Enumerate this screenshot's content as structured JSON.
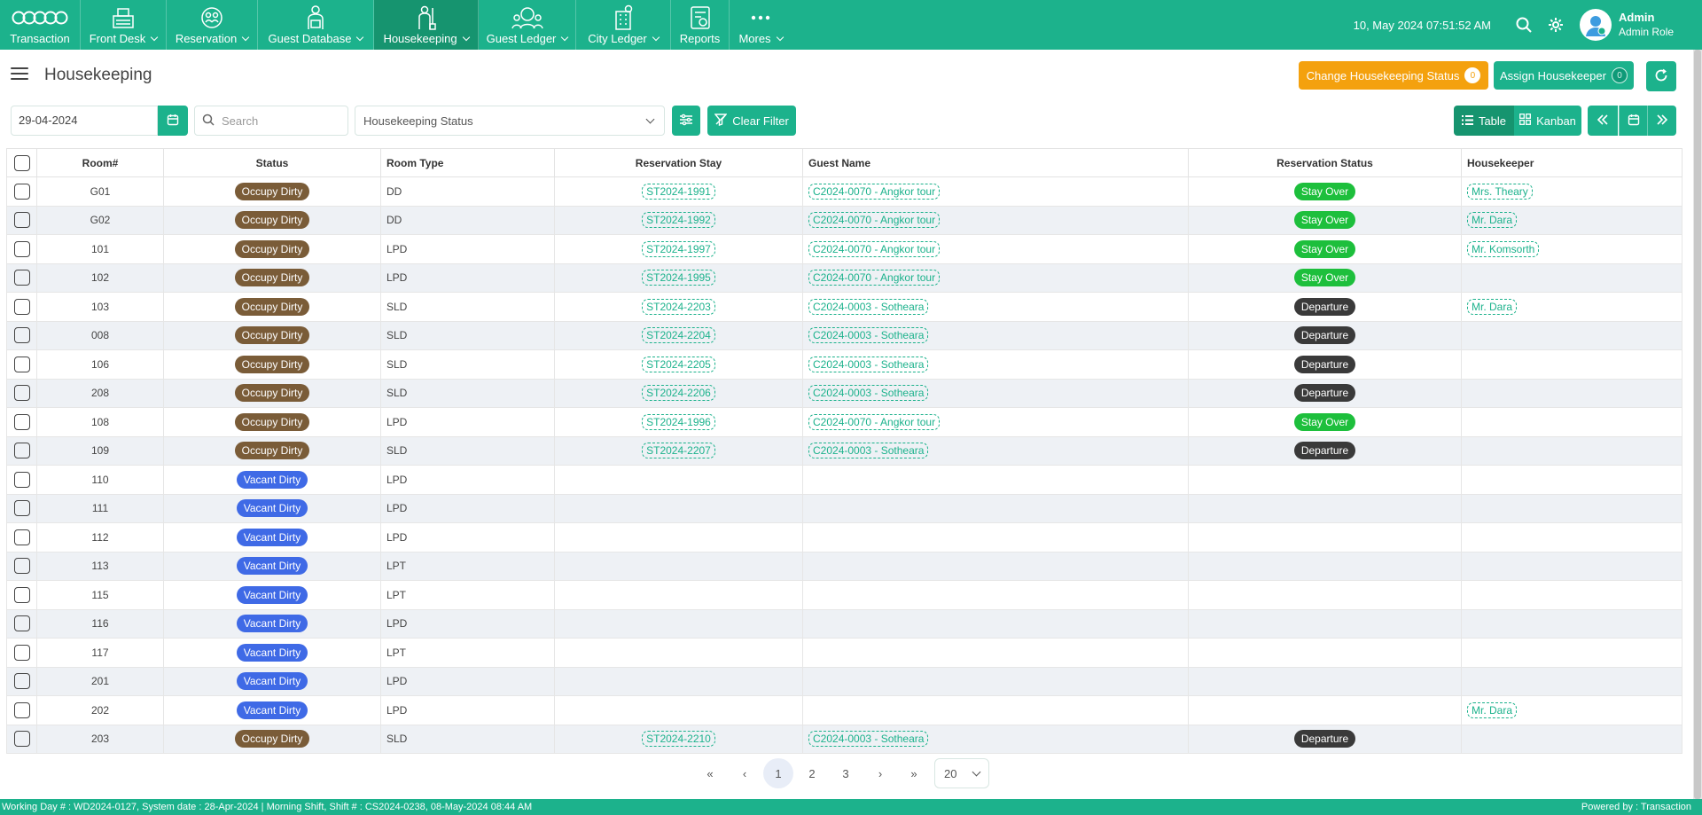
{
  "nav": {
    "items": [
      {
        "label": "Transaction",
        "icon": "transaction-icon",
        "caret": false
      },
      {
        "label": "Front Desk",
        "icon": "front-desk-icon",
        "caret": true
      },
      {
        "label": "Reservation",
        "icon": "reservation-icon",
        "caret": true
      },
      {
        "label": "Guest Database",
        "icon": "guest-database-icon",
        "caret": true
      },
      {
        "label": "Housekeeping",
        "icon": "housekeeping-icon",
        "caret": true,
        "active": true
      },
      {
        "label": "Guest Ledger",
        "icon": "guest-ledger-icon",
        "caret": true
      },
      {
        "label": "City Ledger",
        "icon": "city-ledger-icon",
        "caret": true
      },
      {
        "label": "Reports",
        "icon": "reports-icon",
        "caret": false
      },
      {
        "label": "Mores",
        "icon": "more-icon",
        "caret": true
      }
    ],
    "datetime": "10, May 2024 07:51:52 AM",
    "user_name": "Admin",
    "user_role": "Admin Role"
  },
  "page": {
    "title": "Housekeeping",
    "change_status_label": "Change Housekeeping Status",
    "change_status_count": "0",
    "assign_label": "Assign Housekeeper",
    "assign_count": "0"
  },
  "filters": {
    "date": "29-04-2024",
    "search_placeholder": "Search",
    "status_placeholder": "Housekeeping Status",
    "clear_label": "Clear Filter",
    "view_table": "Table",
    "view_kanban": "Kanban"
  },
  "table": {
    "headers": {
      "room": "Room#",
      "status": "Status",
      "room_type": "Room Type",
      "reservation_stay": "Reservation Stay",
      "guest_name": "Guest Name",
      "reservation_status": "Reservation Status",
      "housekeeper": "Housekeeper"
    },
    "rows": [
      {
        "room": "G01",
        "status": "Occupy Dirty",
        "type": "DD",
        "stay": "ST2024-1991",
        "guest": "C2024-0070 - Angkor tour",
        "res_status": "Stay Over",
        "housekeeper": "Mrs. Theary"
      },
      {
        "room": "G02",
        "status": "Occupy Dirty",
        "type": "DD",
        "stay": "ST2024-1992",
        "guest": "C2024-0070 - Angkor tour",
        "res_status": "Stay Over",
        "housekeeper": "Mr. Dara"
      },
      {
        "room": "101",
        "status": "Occupy Dirty",
        "type": "LPD",
        "stay": "ST2024-1997",
        "guest": "C2024-0070 - Angkor tour",
        "res_status": "Stay Over",
        "housekeeper": "Mr. Komsorth"
      },
      {
        "room": "102",
        "status": "Occupy Dirty",
        "type": "LPD",
        "stay": "ST2024-1995",
        "guest": "C2024-0070 - Angkor tour",
        "res_status": "Stay Over",
        "housekeeper": ""
      },
      {
        "room": "103",
        "status": "Occupy Dirty",
        "type": "SLD",
        "stay": "ST2024-2203",
        "guest": "C2024-0003 - Sotheara",
        "res_status": "Departure",
        "housekeeper": "Mr. Dara"
      },
      {
        "room": "008",
        "status": "Occupy Dirty",
        "type": "SLD",
        "stay": "ST2024-2204",
        "guest": "C2024-0003 - Sotheara",
        "res_status": "Departure",
        "housekeeper": ""
      },
      {
        "room": "106",
        "status": "Occupy Dirty",
        "type": "SLD",
        "stay": "ST2024-2205",
        "guest": "C2024-0003 - Sotheara",
        "res_status": "Departure",
        "housekeeper": ""
      },
      {
        "room": "208",
        "status": "Occupy Dirty",
        "type": "SLD",
        "stay": "ST2024-2206",
        "guest": "C2024-0003 - Sotheara",
        "res_status": "Departure",
        "housekeeper": ""
      },
      {
        "room": "108",
        "status": "Occupy Dirty",
        "type": "LPD",
        "stay": "ST2024-1996",
        "guest": "C2024-0070 - Angkor tour",
        "res_status": "Stay Over",
        "housekeeper": ""
      },
      {
        "room": "109",
        "status": "Occupy Dirty",
        "type": "SLD",
        "stay": "ST2024-2207",
        "guest": "C2024-0003 - Sotheara",
        "res_status": "Departure",
        "housekeeper": ""
      },
      {
        "room": "110",
        "status": "Vacant Dirty",
        "type": "LPD",
        "stay": "",
        "guest": "",
        "res_status": "",
        "housekeeper": ""
      },
      {
        "room": "111",
        "status": "Vacant Dirty",
        "type": "LPD",
        "stay": "",
        "guest": "",
        "res_status": "",
        "housekeeper": ""
      },
      {
        "room": "112",
        "status": "Vacant Dirty",
        "type": "LPD",
        "stay": "",
        "guest": "",
        "res_status": "",
        "housekeeper": ""
      },
      {
        "room": "113",
        "status": "Vacant Dirty",
        "type": "LPT",
        "stay": "",
        "guest": "",
        "res_status": "",
        "housekeeper": ""
      },
      {
        "room": "115",
        "status": "Vacant Dirty",
        "type": "LPT",
        "stay": "",
        "guest": "",
        "res_status": "",
        "housekeeper": ""
      },
      {
        "room": "116",
        "status": "Vacant Dirty",
        "type": "LPD",
        "stay": "",
        "guest": "",
        "res_status": "",
        "housekeeper": ""
      },
      {
        "room": "117",
        "status": "Vacant Dirty",
        "type": "LPT",
        "stay": "",
        "guest": "",
        "res_status": "",
        "housekeeper": ""
      },
      {
        "room": "201",
        "status": "Vacant Dirty",
        "type": "LPD",
        "stay": "",
        "guest": "",
        "res_status": "",
        "housekeeper": ""
      },
      {
        "room": "202",
        "status": "Vacant Dirty",
        "type": "LPD",
        "stay": "",
        "guest": "",
        "res_status": "",
        "housekeeper": "Mr. Dara"
      },
      {
        "room": "203",
        "status": "Occupy Dirty",
        "type": "SLD",
        "stay": "ST2024-2210",
        "guest": "C2024-0003 - Sotheara",
        "res_status": "Departure",
        "housekeeper": ""
      }
    ]
  },
  "pagination": {
    "first": "«",
    "prev": "‹",
    "pages": [
      "1",
      "2",
      "3"
    ],
    "current": "1",
    "next": "›",
    "last": "»",
    "per_page": "20"
  },
  "statusbar": {
    "left": "Working Day # : WD2024-0127, System date : 28-Apr-2024 | Morning Shift, Shift # : CS2024-0238, 08-May-2024 08:44 AM",
    "right": "Powered by : Transaction"
  },
  "colors": {
    "brand": "#1cb28c",
    "orange": "#f4a10e",
    "occupy": "#7a5c38",
    "vacant": "#3f6ae6",
    "stay_over": "#1dbf3c",
    "departure": "#3a3a3a"
  }
}
